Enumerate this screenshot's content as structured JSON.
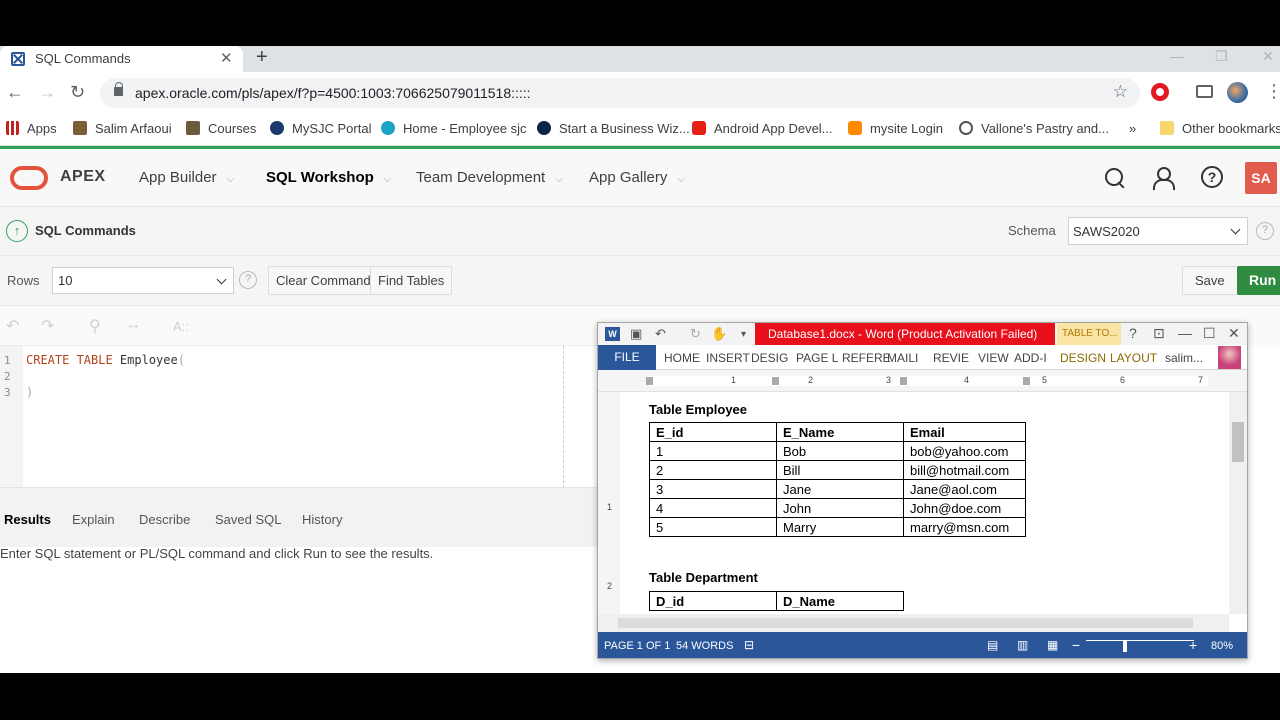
{
  "browser": {
    "tab_title": "SQL Commands",
    "url": "apex.oracle.com/pls/apex/f?p=4500:1003:706625079011518:::::",
    "bookmarks": [
      {
        "label": "Apps"
      },
      {
        "label": "Salim Arfaoui"
      },
      {
        "label": "Courses"
      },
      {
        "label": "MySJC Portal"
      },
      {
        "label": "Home - Employee sjc"
      },
      {
        "label": "Start a Business Wiz..."
      },
      {
        "label": "Android App Devel..."
      },
      {
        "label": "mysite Login"
      },
      {
        "label": "Vallone's Pastry and..."
      },
      {
        "label": "»"
      },
      {
        "label": "Other bookmarks"
      }
    ]
  },
  "apex": {
    "brand": "APEX",
    "nav": [
      "App Builder",
      "SQL Workshop",
      "Team Development",
      "App Gallery"
    ],
    "avatar": "SA",
    "page_title": "SQL Commands",
    "schema_label": "Schema",
    "schema_value": "SAWS2020",
    "rows_label": "Rows",
    "rows_value": "10",
    "clear_command": "Clear Command",
    "find_tables": "Find Tables",
    "save": "Save",
    "run": "Run",
    "editor_lines": [
      "1",
      "2",
      "3"
    ],
    "result_tabs": [
      "Results",
      "Explain",
      "Describe",
      "Saved SQL",
      "History"
    ],
    "result_message": "Enter SQL statement or PL/SQL command and click Run to see the results.",
    "editor_toolbar_hint": "A::"
  },
  "word": {
    "title": "Database1.docx - Word (Product Activation Failed)",
    "table_tools": "TABLE TO...",
    "ribbon_tabs": [
      "FILE",
      "HOME",
      "INSERT",
      "DESIG",
      "PAGE L",
      "REFERE",
      "MAILI",
      "REVIE",
      "VIEW",
      "ADD-I",
      "DESIGN",
      "LAYOUT",
      "salim..."
    ],
    "ruler_numbers": [
      "1",
      "2",
      "3",
      "4",
      "5",
      "6",
      "7"
    ],
    "vruler_numbers": [
      "1",
      "2"
    ],
    "heading1": "Table Employee",
    "employee_headers": [
      "E_id",
      "E_Name",
      "Email"
    ],
    "employee_rows": [
      [
        "1",
        "Bob",
        "bob@yahoo.com"
      ],
      [
        "2",
        "Bill",
        "bill@hotmail.com"
      ],
      [
        "3",
        "Jane",
        "Jane@aol.com"
      ],
      [
        "4",
        "John",
        "John@doe.com"
      ],
      [
        "5",
        "Marry",
        "marry@msn.com"
      ]
    ],
    "heading2": "Table Department",
    "department_headers": [
      "D_id",
      "D_Name"
    ],
    "status_page": "PAGE 1 OF 1",
    "status_words": "54 WORDS",
    "zoom": "80%"
  }
}
